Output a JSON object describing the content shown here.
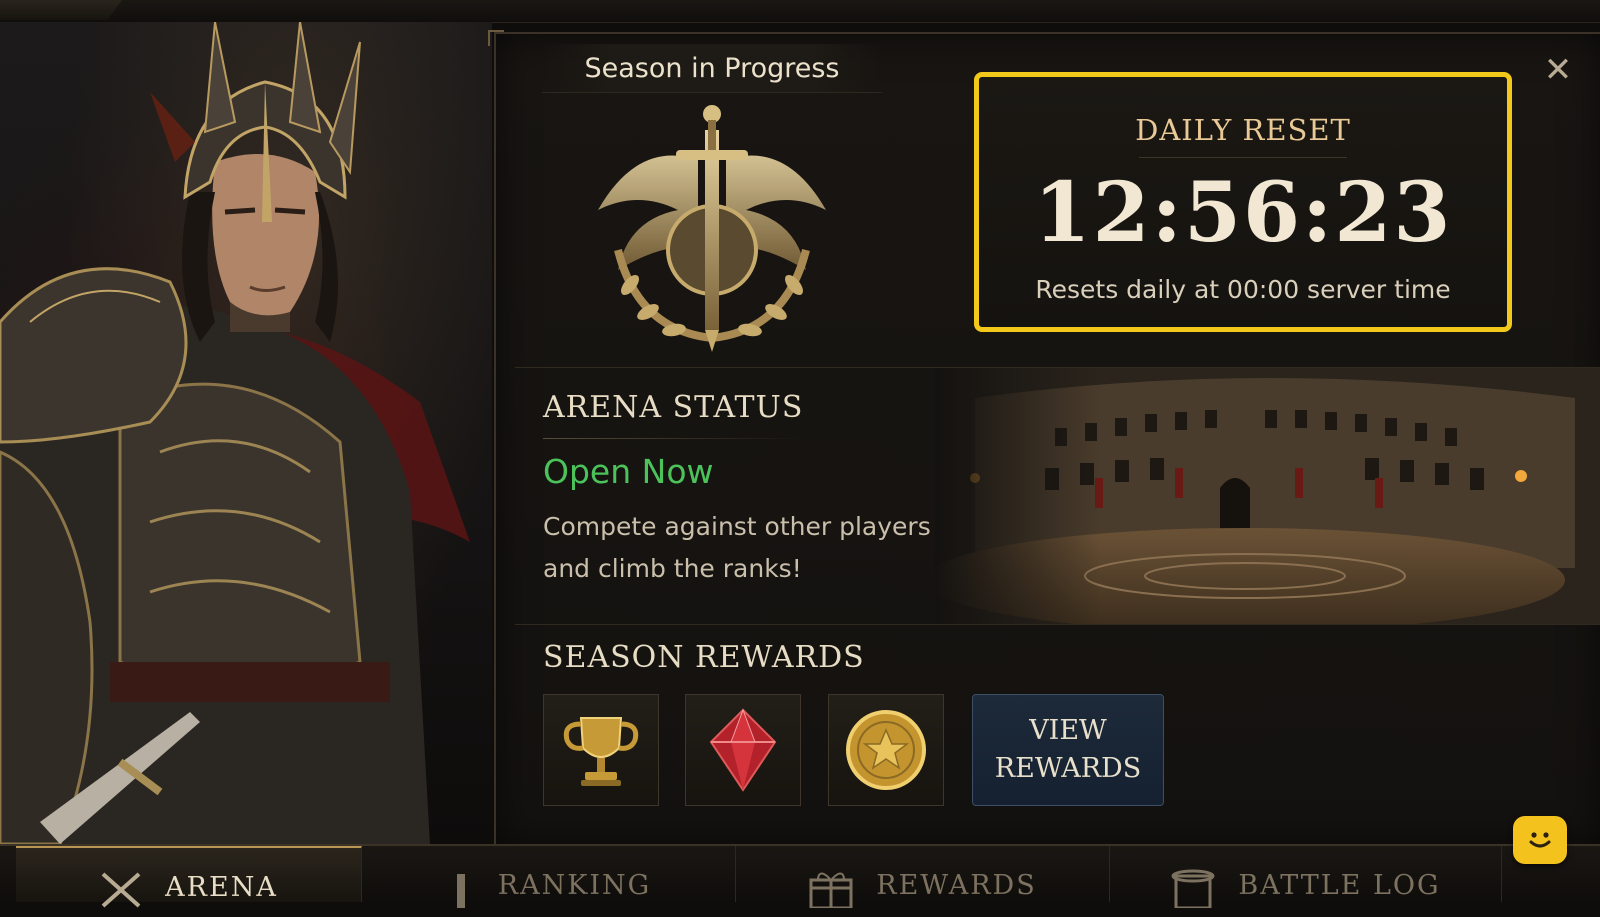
{
  "panel": {
    "season_title": "Season in Progress",
    "close_icon": "close-icon"
  },
  "daily_reset": {
    "label": "DAILY RESET",
    "timer": "12:56:23",
    "note": "Resets daily at 00:00 server time",
    "highlight_color": "#f2c81a"
  },
  "arena": {
    "heading": "ARENA STATUS",
    "status": "Open Now",
    "status_color": "#4cc25a",
    "description": "Compete against other players and climb the ranks!"
  },
  "rewards": {
    "heading": "SEASON REWARDS",
    "items": [
      {
        "icon": "trophy-icon"
      },
      {
        "icon": "gem-icon"
      },
      {
        "icon": "coin-icon"
      }
    ],
    "view_button": "VIEW REWARDS"
  },
  "nav": {
    "tabs": [
      {
        "label": "ARENA",
        "icon": "crossed-swords-icon",
        "active": true
      },
      {
        "label": "RANKING",
        "icon": "ranking-icon",
        "active": false
      },
      {
        "label": "REWARDS",
        "icon": "gift-icon",
        "active": false
      },
      {
        "label": "BATTLE LOG",
        "icon": "scroll-icon",
        "active": false
      }
    ]
  },
  "chat": {
    "icon": "chat-smiley-icon"
  }
}
